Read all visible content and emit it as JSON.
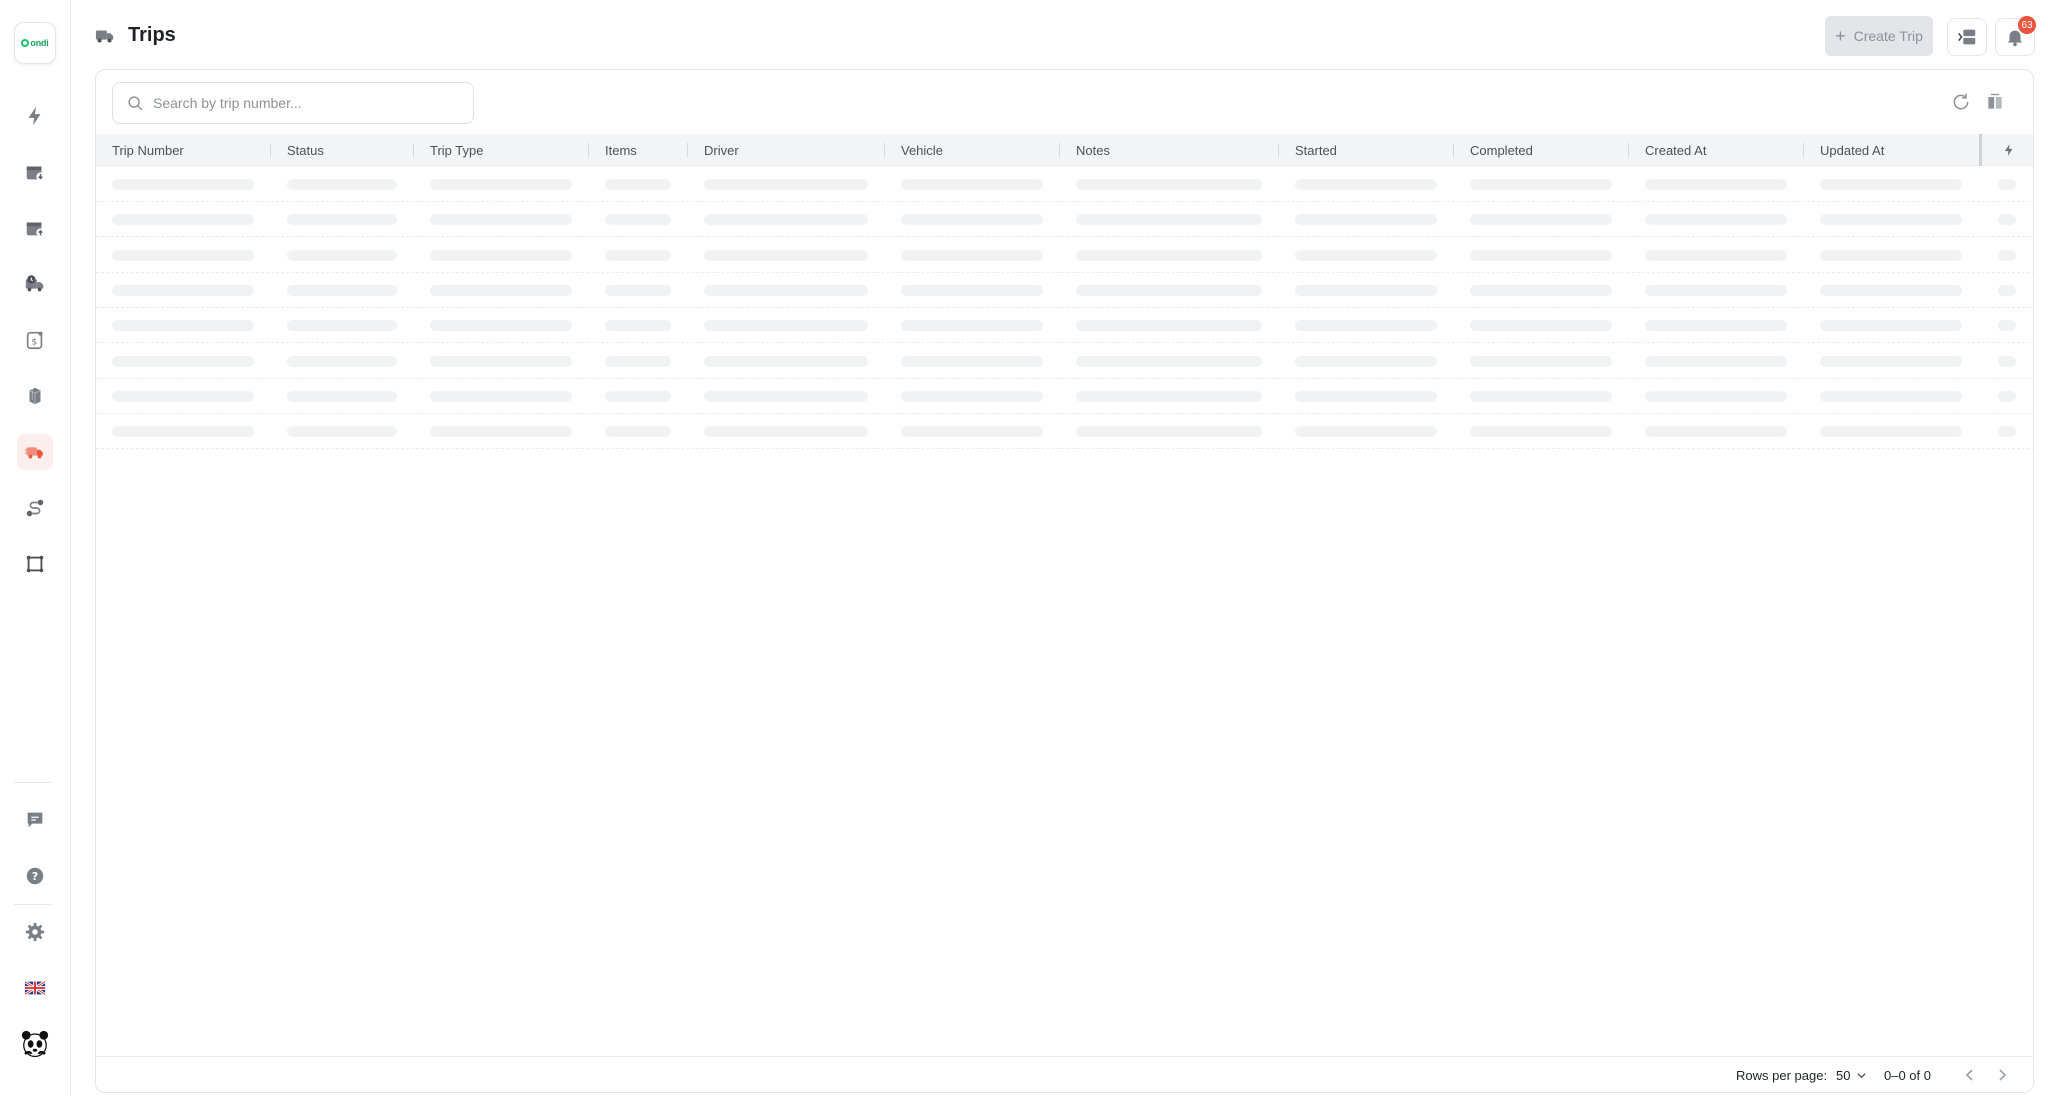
{
  "app": {
    "logo_text": "ondi"
  },
  "sidebar": {
    "items": [
      {
        "name": "dashboard",
        "icon": "lightning-icon"
      },
      {
        "name": "inbound",
        "icon": "box-in-icon"
      },
      {
        "name": "outbound",
        "icon": "box-out-icon"
      },
      {
        "name": "deliveries",
        "icon": "truck-clock-icon"
      },
      {
        "name": "billing",
        "icon": "invoice-icon"
      },
      {
        "name": "products",
        "icon": "cubes-icon"
      },
      {
        "name": "trips",
        "icon": "truck-icon",
        "active": true
      },
      {
        "name": "routes",
        "icon": "route-icon"
      },
      {
        "name": "warehouse",
        "icon": "frame-icon"
      }
    ],
    "bottom": [
      {
        "name": "messages",
        "icon": "chat-icon"
      },
      {
        "name": "help",
        "icon": "question-icon"
      },
      {
        "name": "settings",
        "icon": "gear-icon"
      },
      {
        "name": "language",
        "icon": "uk-flag-icon"
      },
      {
        "name": "account",
        "icon": "panda-avatar-icon"
      }
    ],
    "active_color": "#e8543d"
  },
  "header": {
    "title": "Trips",
    "create_label": "Create Trip",
    "notification_count": "63"
  },
  "search": {
    "placeholder": "Search by trip number..."
  },
  "table": {
    "columns": [
      "Trip Number",
      "Status",
      "Trip Type",
      "Items",
      "Driver",
      "Vehicle",
      "Notes",
      "Started",
      "Completed",
      "Created At",
      "Updated At"
    ],
    "loading_rows": 8
  },
  "footer": {
    "rows_per_page_label": "Rows per page:",
    "rows_per_page_value": "50",
    "range_text": "0–0 of 0"
  },
  "colors": {
    "accent": "#e8543d",
    "brand_green": "#1fbf6c",
    "skeleton": "#f1f2f4"
  }
}
